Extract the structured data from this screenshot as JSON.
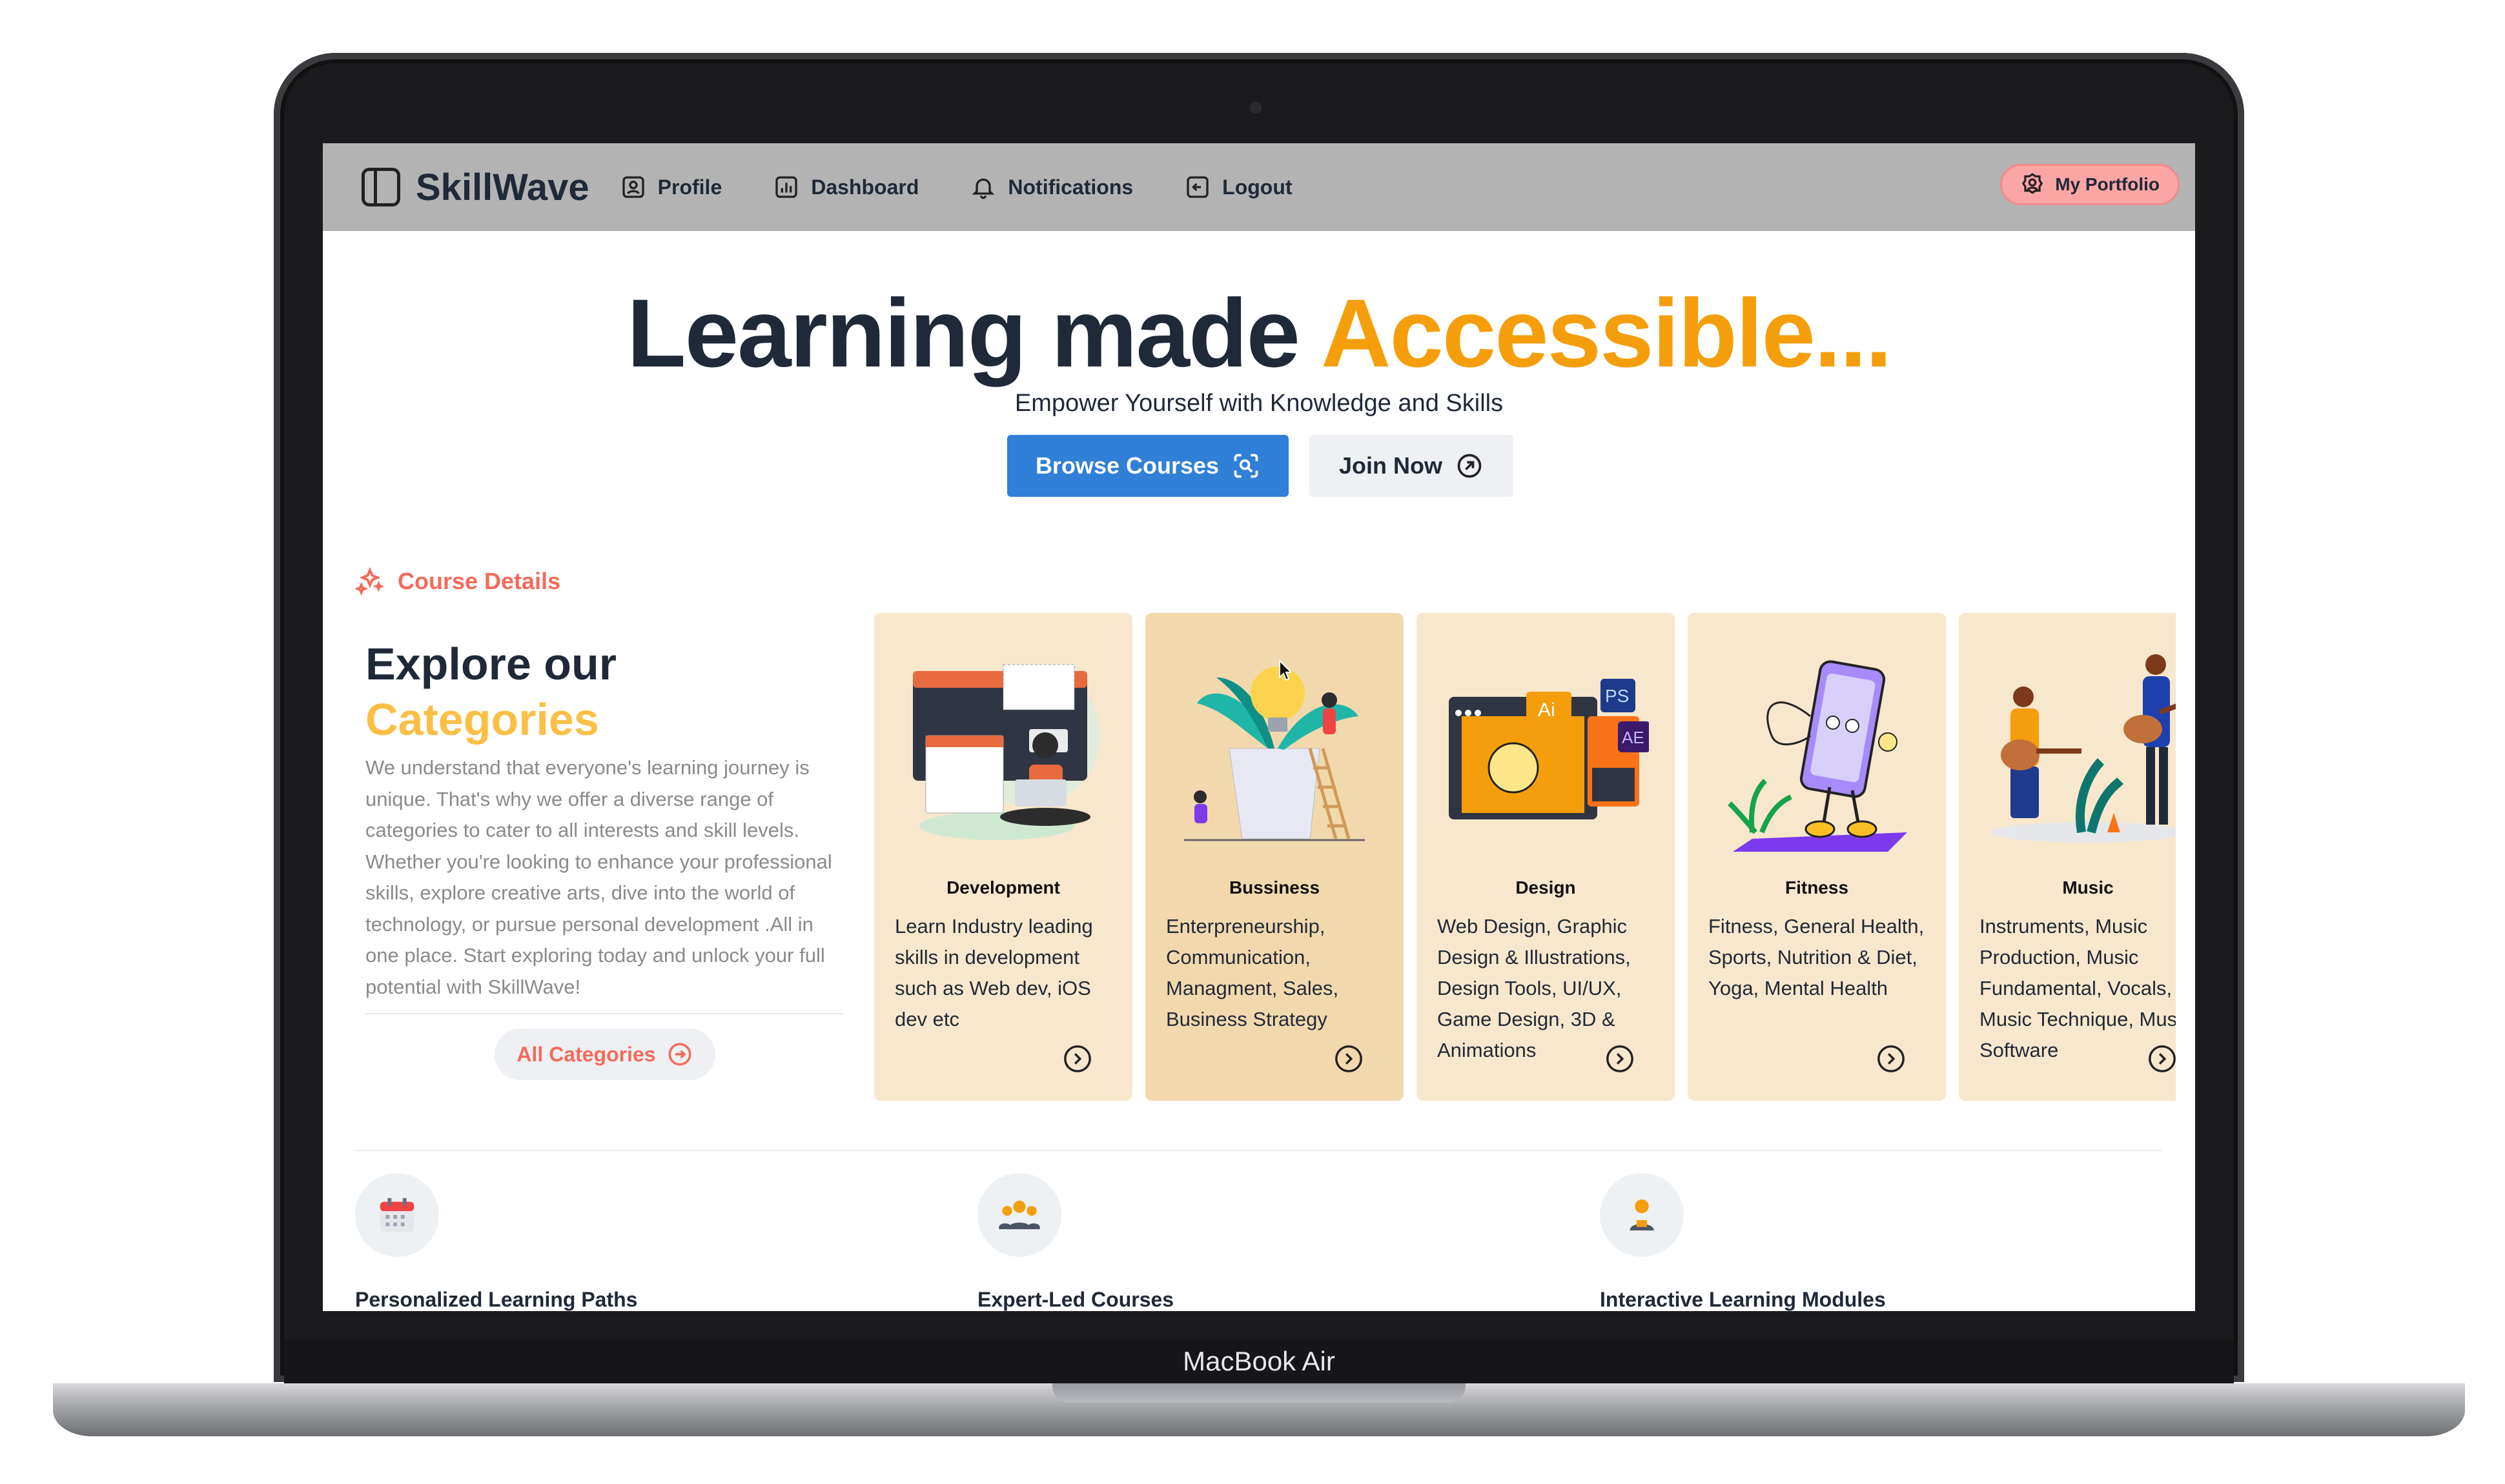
{
  "device": {
    "label": "MacBook Air"
  },
  "navbar": {
    "brand": "SkillWave",
    "items": [
      {
        "label": "Profile",
        "icon": "user-icon"
      },
      {
        "label": "Dashboard",
        "icon": "chart-icon"
      },
      {
        "label": "Notifications",
        "icon": "bell-icon"
      },
      {
        "label": "Logout",
        "icon": "logout-icon"
      }
    ],
    "portfolio_label": "My Portfolio"
  },
  "hero": {
    "title_main": "Learning made",
    "title_accent": "Accessible...",
    "subtitle": "Empower Yourself with Knowledge and Skills",
    "browse_label": "Browse Courses",
    "join_label": "Join Now"
  },
  "course_section": {
    "tag": "Course Details",
    "heading_line1": "Explore our",
    "heading_line2": "Categories",
    "body": "We understand that everyone's learning journey is unique. That's why we offer a diverse range of categories to cater to all interests and skill levels. Whether you're looking to enhance your professional skills, explore creative arts, dive into the world of technology, or pursue personal development .All in one place. Start exploring today and unlock your full potential with SkillWave!",
    "all_categories_label": "All Categories"
  },
  "categories": [
    {
      "title": "Development",
      "desc": "Learn Industry leading skills in development such as Web dev, iOS dev etc"
    },
    {
      "title": "Bussiness",
      "desc": "Enterpreneurship, Communication, Managment, Sales, Business Strategy"
    },
    {
      "title": "Design",
      "desc": "Web Design, Graphic Design & Illustrations, Design Tools, UI/UX, Game Design, 3D & Animations"
    },
    {
      "title": "Fitness",
      "desc": "Fitness, General Health, Sports, Nutrition & Diet, Yoga, Mental Health"
    },
    {
      "title": "Music",
      "desc": "Instruments, Music Production, Music Fundamental, Vocals, Music Technique, Music Software"
    }
  ],
  "features": [
    {
      "label": "Personalized Learning Paths",
      "icon": "calendar-icon"
    },
    {
      "label": "Expert-Led Courses",
      "icon": "group-icon"
    },
    {
      "label": "Interactive Learning Modules",
      "icon": "person-icon"
    }
  ],
  "colors": {
    "accent_orange": "#f59e0b",
    "coral": "#f26b5b",
    "primary_blue": "#2f80d6",
    "card_bg": "#f7e7cc",
    "navbar_bg": "#b3b3b3"
  }
}
